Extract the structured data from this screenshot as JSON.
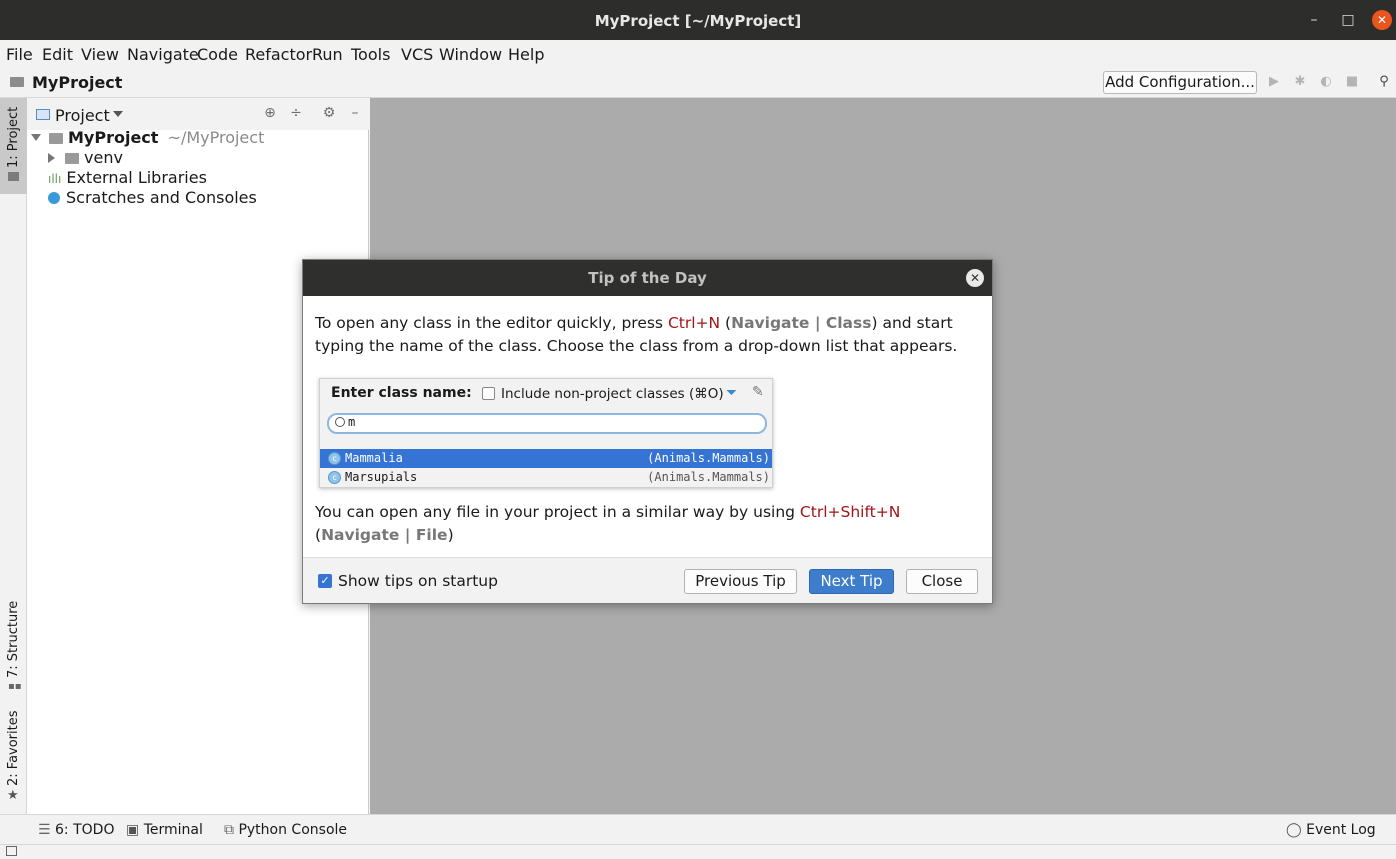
{
  "window": {
    "title": "MyProject [~/MyProject]",
    "minimize": "–",
    "maximize": "□",
    "close": "✕"
  },
  "menu": [
    "File",
    "Edit",
    "View",
    "Navigate",
    "Code",
    "Refactor",
    "Run",
    "Tools",
    "VCS",
    "Window",
    "Help"
  ],
  "navbar": {
    "breadcrumb": "MyProject",
    "add_configuration": "Add Configuration..."
  },
  "left_tabs": {
    "project": "1: Project",
    "structure": "7: Structure",
    "favorites": "2: Favorites"
  },
  "project_panel": {
    "title": "Project",
    "tree": {
      "root_name": "MyProject",
      "root_path": "~/MyProject",
      "venv": "venv",
      "external_libraries": "External Libraries",
      "scratches": "Scratches and Consoles"
    }
  },
  "dialog": {
    "title": "Tip of the Day",
    "tip1": {
      "pre": "To open any class in the editor quickly, press ",
      "shortcut": "Ctrl+N",
      "open_paren": " (",
      "nav_path": "Navigate | Class",
      "post": ") and start typing the name of the class. Choose the class from a drop-down list that appears."
    },
    "popup": {
      "label": "Enter class name:",
      "checkbox_label": "Include non-project classes (⌘O)",
      "query": "m",
      "results": [
        {
          "name": "Mammalia",
          "package": "(Animals.Mammals)"
        },
        {
          "name": "Marsupials",
          "package": "(Animals.Mammals)"
        }
      ]
    },
    "tip2": {
      "pre": "You can open any file in your project in a similar way by using ",
      "shortcut": "Ctrl+Shift+N",
      "open_paren": " (",
      "nav_path": "Navigate | File",
      "close_paren": ")"
    },
    "show_tips_label": "Show tips on startup",
    "show_tips_checked": true,
    "buttons": {
      "previous": "Previous Tip",
      "next": "Next Tip",
      "close": "Close"
    }
  },
  "bottom_tabs": {
    "todo": "6: TODO",
    "terminal": "Terminal",
    "python_console": "Python Console",
    "event_log": "Event Log"
  }
}
